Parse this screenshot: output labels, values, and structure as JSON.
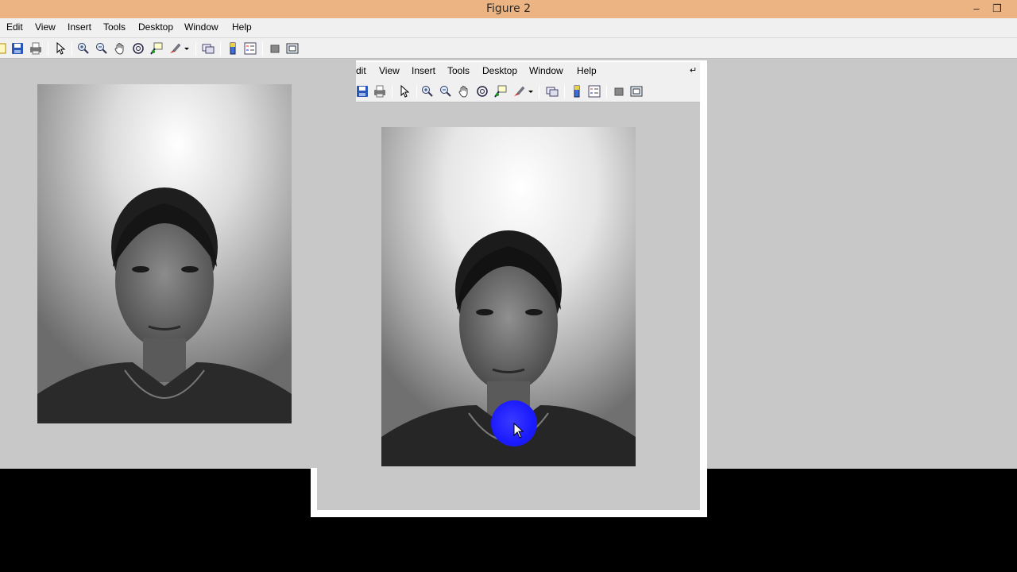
{
  "window": {
    "title": "Figure 2",
    "minimize_icon": "minimize-icon",
    "restore_icon": "restore-icon"
  },
  "menu": {
    "items": [
      "Edit",
      "View",
      "Insert",
      "Tools",
      "Desktop",
      "Window",
      "Help"
    ]
  },
  "toolbar": {
    "icons": [
      "new-figure-icon",
      "save-icon",
      "print-icon",
      "pointer-icon",
      "zoom-in-icon",
      "zoom-out-icon",
      "pan-hand-icon",
      "rotate-3d-icon",
      "data-cursor-icon",
      "brush-icon",
      "link-icon",
      "colorbar-icon",
      "legend-icon",
      "hide-plot-tools-icon",
      "show-plot-tools-icon"
    ]
  },
  "window2": {
    "menu_items": [
      "dit",
      "View",
      "Insert",
      "Tools",
      "Desktop",
      "Window",
      "Help"
    ],
    "dock_icon": "dock-arrow-icon"
  },
  "images": [
    {
      "label": "grayscale-portrait"
    },
    {
      "label": "grayscale-portrait-enhanced"
    }
  ],
  "colors": {
    "titlebar": "#ecb482",
    "menubar": "#f0f0f0",
    "figure_bg": "#c8c8c8",
    "cursor_highlight": "#1a1aff"
  }
}
